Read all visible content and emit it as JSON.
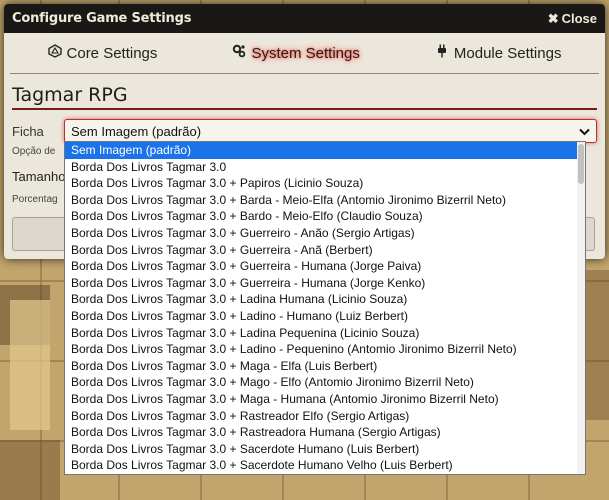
{
  "window": {
    "title": "Configure Game Settings",
    "close_label": "Close"
  },
  "tabs": [
    {
      "label": "Core Settings",
      "icon": "dice-icon",
      "active": false
    },
    {
      "label": "System Settings",
      "icon": "gears-icon",
      "active": true
    },
    {
      "label": "Module Settings",
      "icon": "plug-icon",
      "active": false
    }
  ],
  "section": {
    "title": "Tagmar RPG"
  },
  "settings": {
    "ficha_label": "Ficha",
    "ficha_value": "Sem Imagem (padrão)",
    "ficha_hint": "Opção de",
    "tamanho_label": "Tamanho",
    "tamanho_hint": "Porcentag"
  },
  "dropdown": {
    "options": [
      "Sem Imagem (padrão)",
      "Borda Dos Livros Tagmar 3.0",
      "Borda Dos Livros Tagmar 3.0 + Papiros (Licinio Souza)",
      "Borda Dos Livros Tagmar 3.0 + Barda - Meio-Elfa (Antomio Jironimo Bizerril Neto)",
      "Borda Dos Livros Tagmar 3.0 + Bardo - Meio-Elfo (Claudio Souza)",
      "Borda Dos Livros Tagmar 3.0 + Guerreiro - Anão (Sergio Artigas)",
      "Borda Dos Livros Tagmar 3.0 + Guerreira - Anã (Berbert)",
      "Borda Dos Livros Tagmar 3.0 + Guerreira - Humana (Jorge Paiva)",
      "Borda Dos Livros Tagmar 3.0 + Guerreira - Humana (Jorge Kenko)",
      "Borda Dos Livros Tagmar 3.0 + Ladina Humana (Licinio Souza)",
      "Borda Dos Livros Tagmar 3.0 + Ladino - Humano (Luiz Berbert)",
      "Borda Dos Livros Tagmar 3.0 + Ladina Pequenina (Licinio Souza)",
      "Borda Dos Livros Tagmar 3.0 + Ladino - Pequenino (Antomio Jironimo Bizerril Neto)",
      "Borda Dos Livros Tagmar 3.0 + Maga - Elfa (Luis Berbert)",
      "Borda Dos Livros Tagmar 3.0 + Mago - Elfo (Antomio Jironimo Bizerril Neto)",
      "Borda Dos Livros Tagmar 3.0 + Maga - Humana (Antomio Jironimo Bizerril Neto)",
      "Borda Dos Livros Tagmar 3.0 + Rastreador Elfo (Sergio Artigas)",
      "Borda Dos Livros Tagmar 3.0 + Rastreadora Humana (Sergio Artigas)",
      "Borda Dos Livros Tagmar 3.0 + Sacerdote Humano (Luis Berbert)",
      "Borda Dos Livros Tagmar 3.0 + Sacerdote Humano Velho (Luis Berbert)"
    ],
    "selected_index": 0
  }
}
